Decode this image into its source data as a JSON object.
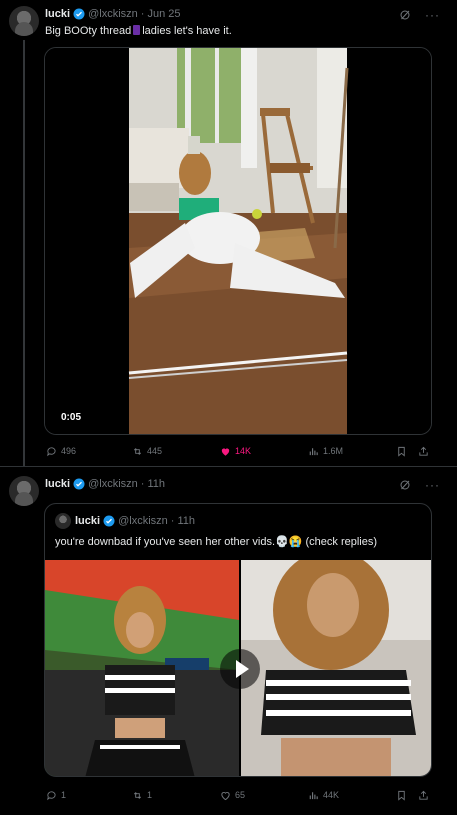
{
  "tweets": [
    {
      "author": "lucki",
      "handle": "@lxckiszn",
      "time": "· Jun 25",
      "text_a": "Big BOOty thread",
      "text_b": "ladies let's have it.",
      "video_duration": "0:05",
      "replies": "496",
      "reposts": "445",
      "likes": "14K",
      "views": "1.6M"
    },
    {
      "author": "lucki",
      "handle": "@lxckiszn",
      "time": "· 11h",
      "quote": {
        "author": "lucki",
        "handle": "@lxckiszn",
        "time": "· 11h",
        "text": "you're downbad if you've seen her other vids.💀😭 (check replies)"
      },
      "replies": "1",
      "reposts": "1",
      "likes": "65",
      "views": "44K"
    }
  ],
  "colors": {
    "background": "#000000",
    "text": "#e7e9ea",
    "muted": "#71767b",
    "verified": "#1d9bf0",
    "like": "#f91880",
    "border": "#2f3336"
  },
  "icons": [
    "verified-badge-icon",
    "grok-icon",
    "more-icon",
    "reply-icon",
    "repost-icon",
    "like-icon",
    "views-icon",
    "bookmark-icon",
    "share-icon",
    "play-icon"
  ]
}
